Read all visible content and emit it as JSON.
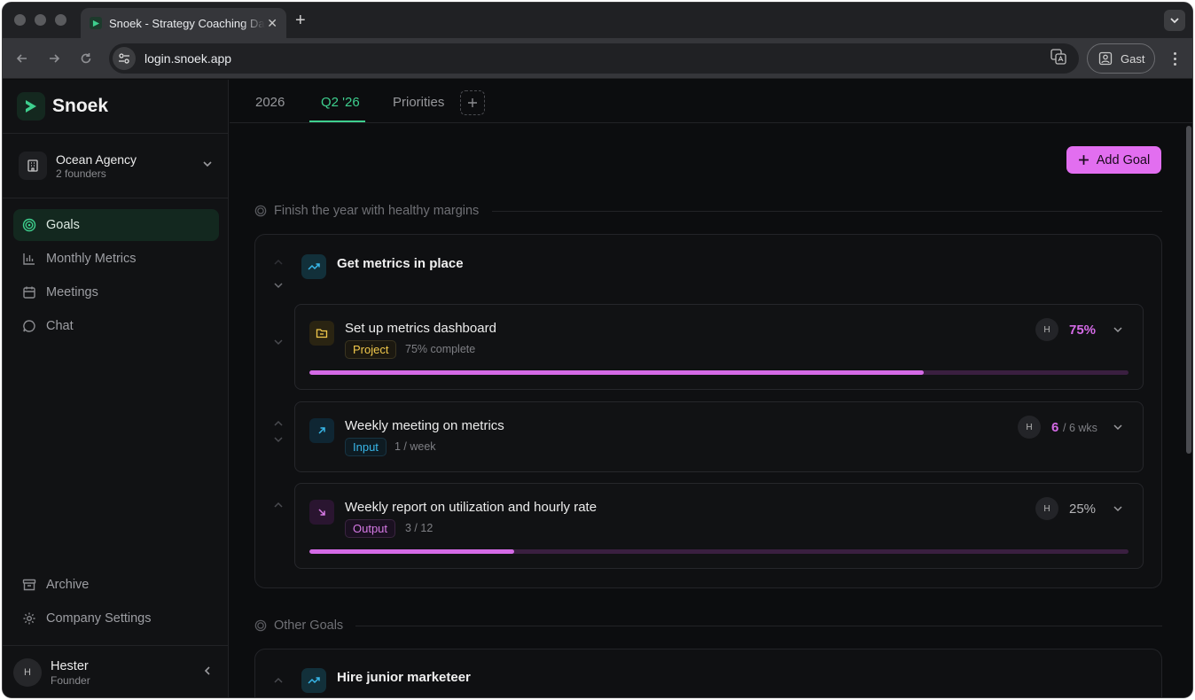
{
  "browser": {
    "tab_title": "Snoek - Strategy Coaching Dashboard",
    "url": "login.snoek.app",
    "profile_name": "Gast"
  },
  "sidebar": {
    "brand": "Snoek",
    "workspace": {
      "name": "Ocean Agency",
      "subtitle": "2 founders"
    },
    "nav": [
      {
        "label": "Goals",
        "icon": "target-icon",
        "active": true
      },
      {
        "label": "Monthly Metrics",
        "icon": "bar-chart-icon"
      },
      {
        "label": "Meetings",
        "icon": "calendar-icon"
      },
      {
        "label": "Chat",
        "icon": "chat-bubble-icon"
      }
    ],
    "bottom_nav": [
      {
        "label": "Archive",
        "icon": "archive-icon"
      },
      {
        "label": "Company Settings",
        "icon": "gear-icon"
      }
    ],
    "user": {
      "initial": "H",
      "name": "Hester",
      "role": "Founder"
    }
  },
  "main": {
    "tabs": [
      {
        "label": "2026"
      },
      {
        "label": "Q2 '26",
        "active": true
      },
      {
        "label": "Priorities"
      }
    ],
    "add_goal_label": "Add Goal",
    "sections": [
      {
        "title": "Finish the year with healthy margins",
        "goals": [
          {
            "title": "Get metrics in place",
            "items": [
              {
                "title": "Set up metrics dashboard",
                "badge": "Project",
                "meta": "75% complete",
                "owner": "H",
                "value": "75%",
                "progress": 0.75
              },
              {
                "title": "Weekly meeting on metrics",
                "badge": "Input",
                "meta": "1 / week",
                "owner": "H",
                "value": "6",
                "value_suffix": "/ 6 wks"
              },
              {
                "title": "Weekly report on utilization and hourly rate",
                "badge": "Output",
                "meta": "3 / 12",
                "owner": "H",
                "value": "25%",
                "progress": 0.25
              }
            ]
          }
        ]
      },
      {
        "title": "Other Goals",
        "goals": [
          {
            "title": "Hire junior marketeer"
          }
        ]
      }
    ]
  },
  "colors": {
    "accent_green": "#3ecf8e",
    "accent_pink": "#e26ef0",
    "project_yellow": "#f2c94c",
    "input_blue": "#38b6e8"
  }
}
